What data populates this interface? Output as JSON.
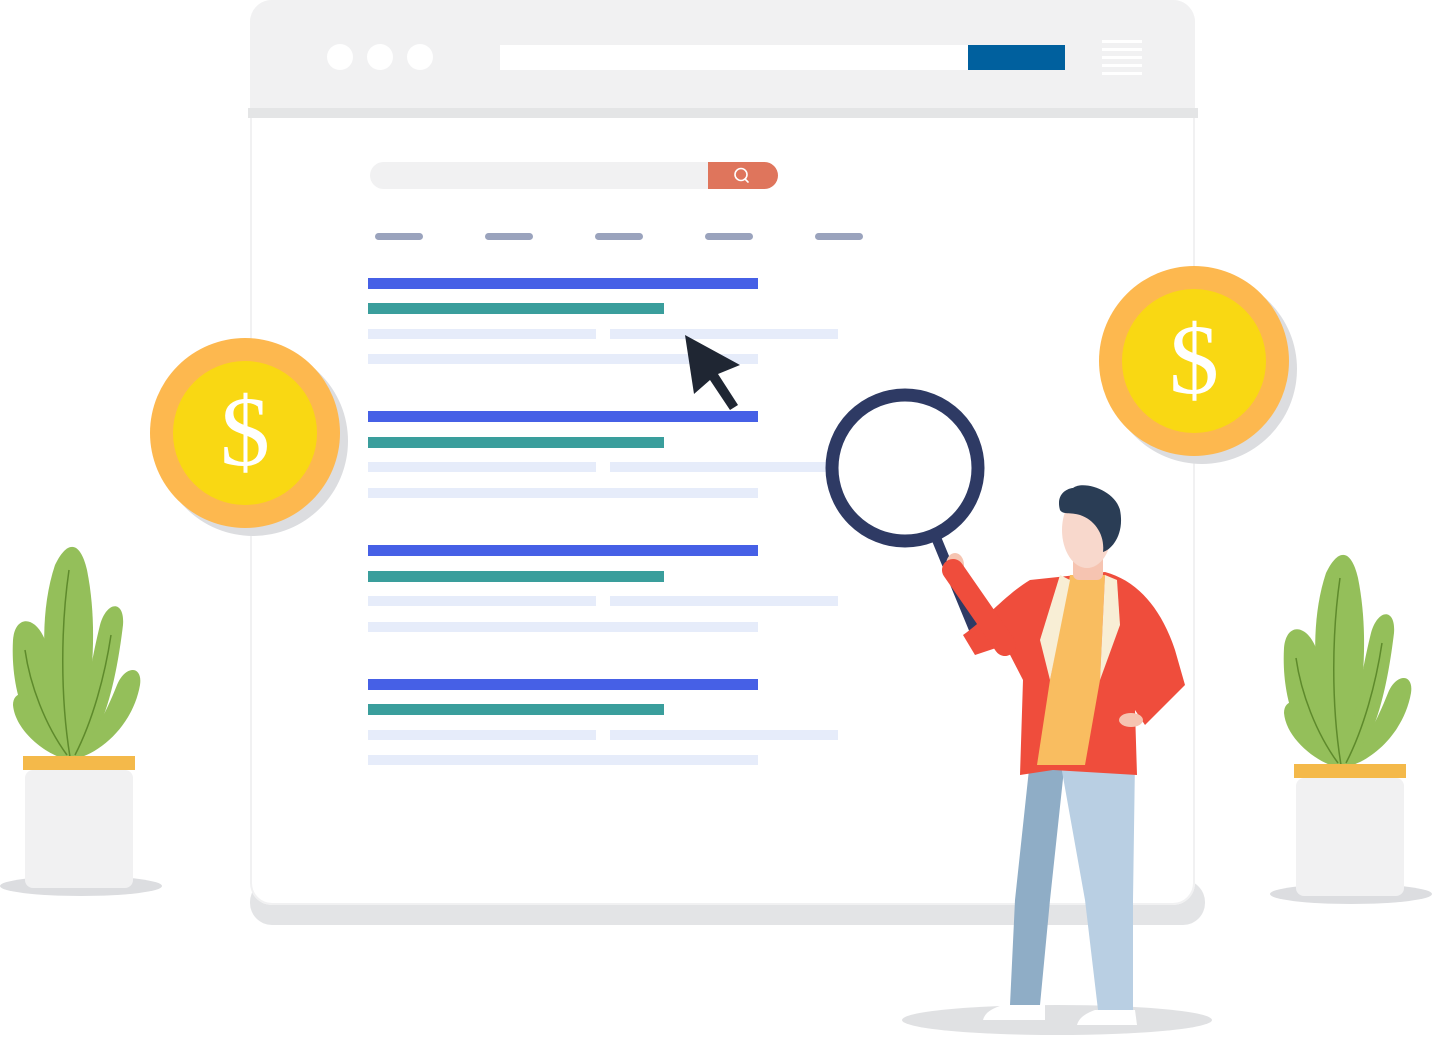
{
  "colors": {
    "browser_chrome": "#f1f1f2",
    "url_button": "#00609e",
    "search_button": "#df755c",
    "nav_tab": "#9aa3bd",
    "result_title": "#4660e6",
    "result_url": "#3a9e9c",
    "result_snippet": "#e6ecfa",
    "coin_outer": "#fdb84f",
    "coin_inner": "#f9d813",
    "leaf": "#94bf5a",
    "pot_rim": "#f4b94a",
    "jacket": "#ef4d3c",
    "shirt": "#f9bd60",
    "pants": "#b9cfe3",
    "hair": "#2a3d55",
    "magnifier": "#2e3a64"
  },
  "icons": {
    "window_dots": "window-dots-icon",
    "menu": "hamburger-menu-icon",
    "search": "search-icon",
    "cursor": "mouse-pointer-icon",
    "coin": "dollar-coin-icon",
    "magnifier": "magnifying-glass-icon",
    "plant": "potted-plant-icon",
    "person": "person-icon"
  },
  "coins": [
    {
      "symbol": "$"
    },
    {
      "symbol": "$"
    }
  ],
  "results": [
    {},
    {},
    {},
    {}
  ],
  "nav_tabs": [
    {},
    {},
    {},
    {},
    {}
  ]
}
